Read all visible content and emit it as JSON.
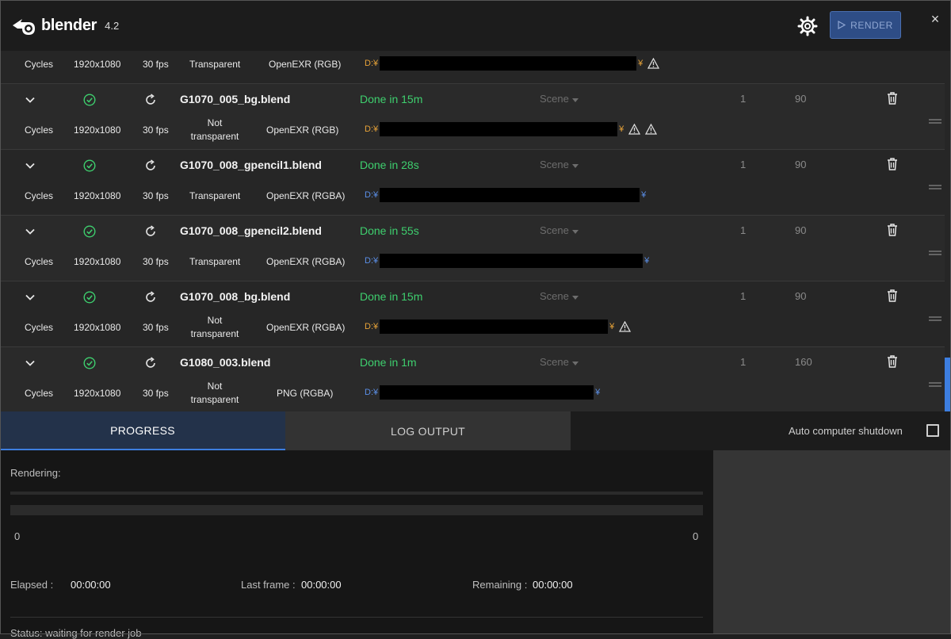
{
  "header": {
    "app_name": "blender",
    "version": "4.2",
    "render_label": "RENDER",
    "close_symbol": "×"
  },
  "top_partial_row": {
    "engine": "Cycles",
    "resolution": "1920x1080",
    "fps": "30 fps",
    "transparency": "Transparent",
    "format": "OpenEXR (RGB)",
    "path_prefix": "D:¥",
    "path_suffix": "¥",
    "path_color": "orange",
    "warnings": 1
  },
  "jobs": [
    {
      "filename": "G1070_005_bg.blend",
      "status": "Done in 15m",
      "scene": "Scene",
      "start": "1",
      "end": "90",
      "engine": "Cycles",
      "resolution": "1920x1080",
      "fps": "30 fps",
      "transparency": "Not transparent",
      "format": "OpenEXR (RGB)",
      "path_prefix": "D:¥",
      "path_suffix": "¥",
      "path_color": "orange",
      "warnings": 2
    },
    {
      "filename": "G1070_008_gpencil1.blend",
      "status": "Done in 28s",
      "scene": "Scene",
      "start": "1",
      "end": "90",
      "engine": "Cycles",
      "resolution": "1920x1080",
      "fps": "30 fps",
      "transparency": "Transparent",
      "format": "OpenEXR (RGBA)",
      "path_prefix": "D:¥",
      "path_suffix": "¥",
      "path_color": "blue",
      "warnings": 0
    },
    {
      "filename": "G1070_008_gpencil2.blend",
      "status": "Done in 55s",
      "scene": "Scene",
      "start": "1",
      "end": "90",
      "engine": "Cycles",
      "resolution": "1920x1080",
      "fps": "30 fps",
      "transparency": "Transparent",
      "format": "OpenEXR (RGBA)",
      "path_prefix": "D:¥",
      "path_suffix": "¥",
      "path_color": "blue",
      "warnings": 0
    },
    {
      "filename": "G1070_008_bg.blend",
      "status": "Done in 15m",
      "scene": "Scene",
      "start": "1",
      "end": "90",
      "engine": "Cycles",
      "resolution": "1920x1080",
      "fps": "30 fps",
      "transparency": "Not transparent",
      "format": "OpenEXR (RGBA)",
      "path_prefix": "D:¥",
      "path_suffix": "¥",
      "path_color": "orange",
      "warnings": 1
    },
    {
      "filename": "G1080_003.blend",
      "status": "Done in 1m",
      "scene": "Scene",
      "start": "1",
      "end": "160",
      "engine": "Cycles",
      "resolution": "1920x1080",
      "fps": "30 fps",
      "transparency": "Not transparent",
      "format": "PNG (RGBA)",
      "path_prefix": "D:¥",
      "path_suffix": "¥",
      "path_color": "blue",
      "warnings": 0
    }
  ],
  "tabs": {
    "progress": "PROGRESS",
    "log": "LOG OUTPUT",
    "shutdown_label": "Auto computer shutdown"
  },
  "progress": {
    "rendering_label": "Rendering:",
    "min": "0",
    "max": "0",
    "elapsed_label": "Elapsed :",
    "elapsed_value": "00:00:00",
    "last_frame_label": "Last frame :",
    "last_frame_value": "00:00:00",
    "remaining_label": "Remaining :",
    "remaining_value": "00:00:00",
    "status_text": "Status: waiting for render job"
  },
  "colors": {
    "accent": "#3d7ee0",
    "done_green": "#3ecf6e",
    "orange_path": "#e8a338",
    "blue_path": "#5b8fe8"
  }
}
